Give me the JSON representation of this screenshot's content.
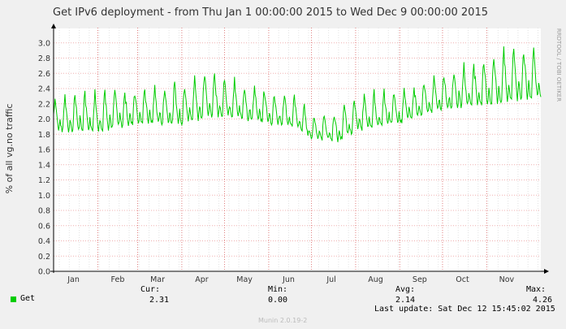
{
  "chart_data": {
    "type": "line",
    "title": "Get IPv6 deployment - from Thu Jan  1 00:00:00 2015 to Wed Dec  9 00:00:00 2015",
    "ylabel": "% of all vg.no traffic",
    "xlabel": "",
    "side_label": "RRDTOOL / TOBI OETIKER",
    "ylim": [
      0,
      3.2
    ],
    "yticks": [
      "0.0",
      "0.2",
      "0.4",
      "0.6",
      "0.8",
      "1.0",
      "1.2",
      "1.4",
      "1.6",
      "1.8",
      "2.0",
      "2.2",
      "2.4",
      "2.6",
      "2.8",
      "3.0"
    ],
    "x_ticks": [
      "Jan",
      "Feb",
      "Mar",
      "Apr",
      "May",
      "Jun",
      "Jul",
      "Aug",
      "Sep",
      "Oct",
      "Nov"
    ],
    "x_range": [
      "2015-01-01",
      "2015-12-09"
    ],
    "grid": true,
    "series": [
      {
        "name": "Get",
        "color": "#00cc00",
        "weekly_trend": [
          {
            "date": "2015-01-01",
            "base": 1.85,
            "peak": 2.35
          },
          {
            "date": "2015-02-01",
            "base": 1.85,
            "peak": 2.45
          },
          {
            "date": "2015-03-01",
            "base": 1.95,
            "peak": 2.45
          },
          {
            "date": "2015-04-01",
            "base": 1.95,
            "peak": 2.55
          },
          {
            "date": "2015-04-22",
            "base": 2.05,
            "peak": 2.75
          },
          {
            "date": "2015-05-01",
            "base": 2.05,
            "peak": 2.6
          },
          {
            "date": "2015-06-01",
            "base": 1.95,
            "peak": 2.45
          },
          {
            "date": "2015-06-20",
            "base": 1.9,
            "peak": 2.35
          },
          {
            "date": "2015-07-01",
            "base": 1.75,
            "peak": 2.1
          },
          {
            "date": "2015-07-20",
            "base": 1.72,
            "peak": 2.15
          },
          {
            "date": "2015-08-01",
            "base": 1.85,
            "peak": 2.4
          },
          {
            "date": "2015-09-01",
            "base": 1.95,
            "peak": 2.45
          },
          {
            "date": "2015-10-01",
            "base": 2.15,
            "peak": 2.65
          },
          {
            "date": "2015-11-01",
            "base": 2.2,
            "peak": 2.9
          },
          {
            "date": "2015-11-20",
            "base": 2.25,
            "peak": 3.1
          },
          {
            "date": "2015-12-09",
            "base": 2.3,
            "peak": 3.0
          }
        ]
      }
    ]
  },
  "legend": {
    "series_name": "Get",
    "color": "#00cc00",
    "cur_label": "Cur:",
    "min_label": "Min:",
    "avg_label": "Avg:",
    "max_label": "Max:",
    "cur": "2.31",
    "min": "0.00",
    "avg": "2.14",
    "max": "4.26",
    "last_update": "Last update: Sat Dec 12 15:45:02 2015"
  },
  "footer": "Munin 2.0.19-2"
}
